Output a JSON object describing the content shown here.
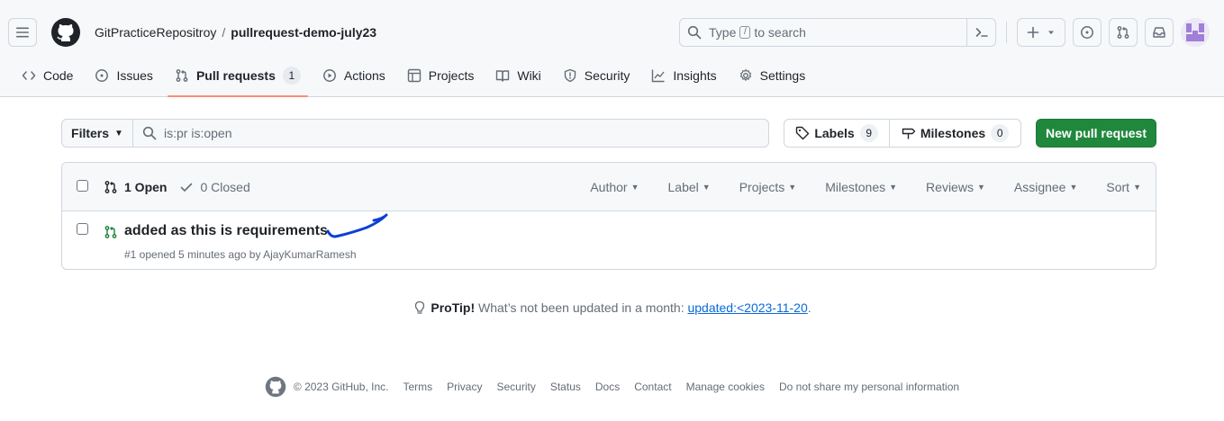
{
  "header": {
    "owner": "GitPracticeRepositroy",
    "separator": "/",
    "repo": "pullrequest-demo-july23",
    "search_prefix": "Type",
    "search_key": "/",
    "search_suffix": "to search"
  },
  "nav": {
    "tabs": [
      {
        "label": "Code",
        "icon": "code-icon"
      },
      {
        "label": "Issues",
        "icon": "issue-opened-icon"
      },
      {
        "label": "Pull requests",
        "icon": "git-pull-request-icon",
        "count": "1",
        "selected": true
      },
      {
        "label": "Actions",
        "icon": "play-icon"
      },
      {
        "label": "Projects",
        "icon": "table-icon"
      },
      {
        "label": "Wiki",
        "icon": "book-icon"
      },
      {
        "label": "Security",
        "icon": "shield-icon"
      },
      {
        "label": "Insights",
        "icon": "graph-icon"
      },
      {
        "label": "Settings",
        "icon": "gear-icon"
      }
    ]
  },
  "subnav": {
    "filters_label": "Filters",
    "filter_value": "is:pr is:open",
    "labels_label": "Labels",
    "labels_count": "9",
    "milestones_label": "Milestones",
    "milestones_count": "0",
    "new_pr_label": "New pull request"
  },
  "list": {
    "open_label": "1 Open",
    "closed_label": "0 Closed",
    "sorts": [
      "Author",
      "Label",
      "Projects",
      "Milestones",
      "Reviews",
      "Assignee",
      "Sort"
    ],
    "items": [
      {
        "title": "added as this is requirements",
        "meta": "#1 opened 5 minutes ago by AjayKumarRamesh"
      }
    ]
  },
  "protip": {
    "strong": "ProTip!",
    "text": "What’s not been updated in a month:",
    "link": "updated:<2023-11-20",
    "end": "."
  },
  "footer": {
    "copyright": "© 2023 GitHub, Inc.",
    "links": [
      "Terms",
      "Privacy",
      "Security",
      "Status",
      "Docs",
      "Contact",
      "Manage cookies",
      "Do not share my personal information"
    ]
  },
  "colors": {
    "accent_green": "#1f883d",
    "open_green": "#1a7f37",
    "link_blue": "#0969da",
    "tab_underline": "#fd8c73",
    "scribble_blue": "#0b3fd6"
  }
}
